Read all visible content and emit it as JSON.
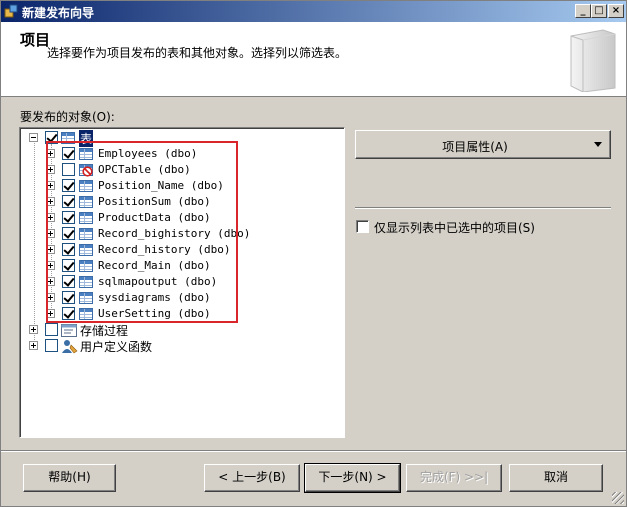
{
  "window": {
    "title": "新建发布向导",
    "controls": [
      "_",
      "□",
      "×"
    ]
  },
  "header": {
    "title": "项目",
    "subtitle": "选择要作为项目发布的表和其他对象。选择列以筛选表。"
  },
  "objects_label": "要发布的对象(O):",
  "tree": {
    "root": {
      "label": "表",
      "checked": true,
      "expanded": true
    },
    "tables": [
      {
        "label": "Employees (dbo)",
        "checked": true,
        "icon": "table-icon"
      },
      {
        "label": "OPCTable (dbo)",
        "checked": false,
        "icon": "table-blocked-icon"
      },
      {
        "label": "Position_Name (dbo)",
        "checked": true,
        "icon": "table-icon"
      },
      {
        "label": "PositionSum (dbo)",
        "checked": true,
        "icon": "table-icon"
      },
      {
        "label": "ProductData (dbo)",
        "checked": true,
        "icon": "table-icon"
      },
      {
        "label": "Record_bighistory (dbo)",
        "checked": true,
        "icon": "table-icon"
      },
      {
        "label": "Record_history (dbo)",
        "checked": true,
        "icon": "table-icon"
      },
      {
        "label": "Record_Main (dbo)",
        "checked": true,
        "icon": "table-icon"
      },
      {
        "label": "sqlmapoutput (dbo)",
        "checked": true,
        "icon": "table-icon"
      },
      {
        "label": "sysdiagrams (dbo)",
        "checked": true,
        "icon": "table-icon"
      },
      {
        "label": "UserSetting (dbo)",
        "checked": true,
        "icon": "table-icon"
      }
    ],
    "others": [
      {
        "label": "存储过程",
        "checked": false,
        "icon": "stored-procedure-icon"
      },
      {
        "label": "用户定义函数",
        "checked": false,
        "icon": "user-function-icon"
      }
    ]
  },
  "article_properties_label": "项目属性(A)",
  "show_selected_label": "仅显示列表中已选中的项目(S)",
  "show_selected_checked": false,
  "buttons": {
    "help": "帮助(H)",
    "back": "< 上一步(B)",
    "next": "下一步(N) >",
    "finish": "完成(F) >>|",
    "cancel": "取消"
  },
  "colors": {
    "titlebar_start": "#0a246a",
    "titlebar_end": "#a6caf0",
    "highlight_box": "#d9262a",
    "selection": "#0a246a"
  }
}
